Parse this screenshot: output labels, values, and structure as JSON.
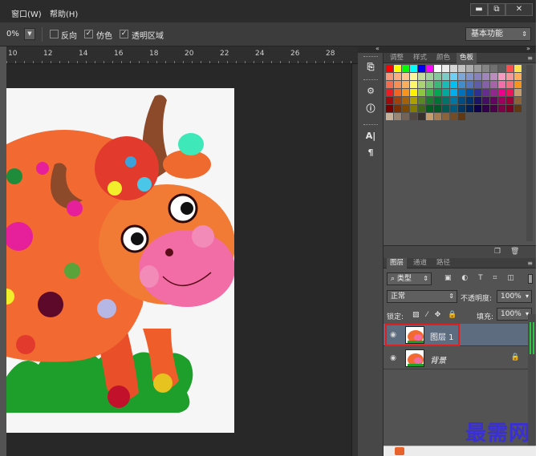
{
  "menubar": {
    "items": [
      {
        "label": "窗口(W)"
      },
      {
        "label": "帮助(H)"
      }
    ],
    "window_buttons": [
      "▬",
      "⧉",
      "✕"
    ]
  },
  "options_bar": {
    "zoom_value": "0%",
    "checkboxes": [
      {
        "label": "反向",
        "checked": false,
        "mark": ""
      },
      {
        "label": "仿色",
        "checked": true,
        "mark": "✓"
      },
      {
        "label": "透明区域",
        "checked": true,
        "mark": "✓"
      }
    ],
    "workspace": "基本功能"
  },
  "ruler": {
    "ticks": [
      "10",
      "12",
      "14",
      "16",
      "18",
      "20",
      "22",
      "24",
      "26",
      "28"
    ]
  },
  "panel_collapse": {
    "left": "«",
    "right": "»"
  },
  "toolstrip": {
    "buttons": [
      {
        "name": "history",
        "glyph": "⎘"
      },
      {
        "name": "actions",
        "glyph": "⚙"
      },
      {
        "name": "info",
        "glyph": "ⓘ"
      },
      {
        "name": "character",
        "glyph": "A|"
      },
      {
        "name": "paragraph",
        "glyph": "¶"
      }
    ]
  },
  "swatches_panel": {
    "tabs": [
      "调整",
      "样式",
      "颜色",
      "色板"
    ],
    "active_tab": 3,
    "menu_glyph": "≡",
    "rows": [
      [
        "#ff0000",
        "#ffff00",
        "#00ff00",
        "#00ffff",
        "#0000ff",
        "#ff00ff",
        "#ffffff",
        "#ebebeb",
        "#d6d6d6",
        "#c2c2c2",
        "#adadad",
        "#999999",
        "#858585",
        "#707070",
        "#5c5c5c",
        "#ff4d4d",
        "#ffe24d"
      ],
      [
        "#f7977a",
        "#fbad82",
        "#fdc68c",
        "#fff79a",
        "#c4df9b",
        "#a3d39c",
        "#82ca9c",
        "#7accc8",
        "#6dcff6",
        "#7da7d9",
        "#8393ca",
        "#8781bd",
        "#a186be",
        "#bd8cbf",
        "#f49ac1",
        "#f5989d",
        "#fbaf5d"
      ],
      [
        "#f26c4f",
        "#f68e56",
        "#fbaf5d",
        "#fff568",
        "#acd373",
        "#7cc576",
        "#3bb878",
        "#1abbb4",
        "#00bff3",
        "#438ccb",
        "#5574b9",
        "#605ca8",
        "#855fa8",
        "#a763a8",
        "#f06eaa",
        "#f26d7d",
        "#f7941d"
      ],
      [
        "#ed1c24",
        "#f26522",
        "#f7941d",
        "#fff200",
        "#8dc63f",
        "#39b54a",
        "#00a651",
        "#00a99d",
        "#00aeef",
        "#0072bc",
        "#0054a6",
        "#2e3192",
        "#662d91",
        "#92278f",
        "#ec008c",
        "#ed145b",
        "#c69c6d"
      ],
      [
        "#9e0b0f",
        "#a0410d",
        "#a36209",
        "#aba000",
        "#598527",
        "#1a7b30",
        "#007236",
        "#00746b",
        "#0076a3",
        "#004b80",
        "#003471",
        "#1b1464",
        "#440e62",
        "#630460",
        "#9e005d",
        "#9e0039",
        "#8c6239"
      ],
      [
        "#790000",
        "#7b2e00",
        "#7d4900",
        "#827b00",
        "#406618",
        "#005e20",
        "#005826",
        "#005952",
        "#005b7f",
        "#003663",
        "#002157",
        "#0d004c",
        "#32004b",
        "#4b0049",
        "#7b0046",
        "#7a0026",
        "#603913"
      ],
      [
        "#c7b299",
        "#998675",
        "#736357",
        "#534741",
        "#37302d",
        "#c69c6d",
        "#a67c52",
        "#8c6239",
        "#754c24",
        "#603913"
      ]
    ]
  },
  "mid_toolbar": {
    "icons": [
      "❐",
      "🗑"
    ]
  },
  "layers_panel": {
    "tabs": [
      "图层",
      "通道",
      "路径"
    ],
    "active_tab": 0,
    "menu_glyph": "≡",
    "filter_value": "类型",
    "filter_icons": "▣ ◐ T ⌗ ◫",
    "blend_mode": "正常",
    "opacity_label": "不透明度:",
    "opacity_value": "100%",
    "lock_label": "锁定:",
    "lock_icons": "▨ ⁄ ✥ 🔒",
    "fill_label": "填充:",
    "fill_value": "100%",
    "layers": [
      {
        "name": "图层 1",
        "selected": true,
        "locked": false
      },
      {
        "name": "背景",
        "selected": false,
        "locked": true
      }
    ],
    "eye_glyph": "◉",
    "lock_glyph": "🔒"
  },
  "watermark": "最需网"
}
